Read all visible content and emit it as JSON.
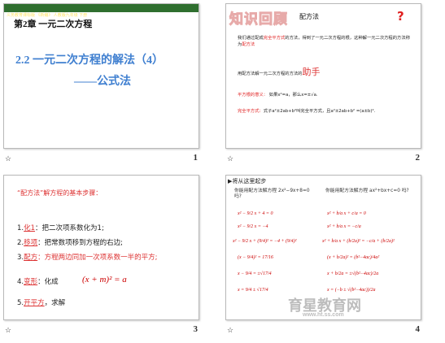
{
  "slides": [
    {
      "number": "1",
      "band_text": "义务教育课标版 《新编》 人教版九年级 下册",
      "chapter": "第2章  一元二次方程",
      "title": "2.2 一元二次方程的解法（4）",
      "subtitle": "——公式法"
    },
    {
      "number": "2",
      "heading": "知识回顾",
      "topic": "配方法",
      "question_mark": "?",
      "para1_a": "我们通过配成",
      "para1_red1": "完全平方式",
      "para1_b": "的方法，得到了一元二次方程的根，这种解一元二次方程的方法称为",
      "para1_red2": "配方法",
      "para2_a": "用配方法解一元二次方程的方法的",
      "para2_big": "助手",
      "para3_label": "平方根的意义：",
      "para3_text": "如果x²=a，那么x=±√a.",
      "para4_label": "完全平方式：",
      "para4_text": "式子a²±2ab+b²叫完全平方式，且a²±2ab+b² =(a±b)²."
    },
    {
      "number": "3",
      "title": "“配方法”解方程的基本步骤：",
      "steps": [
        {
          "n": "1.",
          "label": "化1",
          "text": "：把二次项系数化为1;"
        },
        {
          "n": "2.",
          "label": "移项",
          "text": "：把常数项移到方程的右边;"
        },
        {
          "n": "3.",
          "label": "配方",
          "text": "：方程两边同加一次项系数一半的平方;"
        },
        {
          "n": "4.",
          "label": "变形",
          "text": "：化成"
        },
        {
          "n": "5.",
          "label": "开平方",
          "text": "，求解"
        }
      ],
      "formula": "(x + m)² = a"
    },
    {
      "number": "4",
      "heading": "▶将从这里起步",
      "left_question": "你能用配方法解方程 2x²−9x+8=0 吗?",
      "right_question": "你能用配方法解方程 ax²+bx+c=0 吗?",
      "left_steps": [
        "x² − 9/2 x + 4 = 0",
        "x² − 9/2 x = −4",
        "x² − 9/2 x + (9/4)² = −4 + (9/4)²",
        "(x − 9/4)² = 17/16",
        "x − 9/4 = ±√17/4",
        "x = 9/4 ± √17/4"
      ],
      "right_steps": [
        "x² + b/a x + c/a = 0",
        "x² + b/a x = −c/a",
        "x² + b/a x + (b/2a)² = −c/a + (b/2a)²",
        "(x + b/2a)² = (b²−4ac)/4a²",
        "x + b/2a = ±√(b²−4ac)/2a",
        "x = (−b ± √(b²−4ac))/2a"
      ],
      "watermark_cn": "育星教育网",
      "watermark_url": "www.ht.ss.com"
    }
  ]
}
